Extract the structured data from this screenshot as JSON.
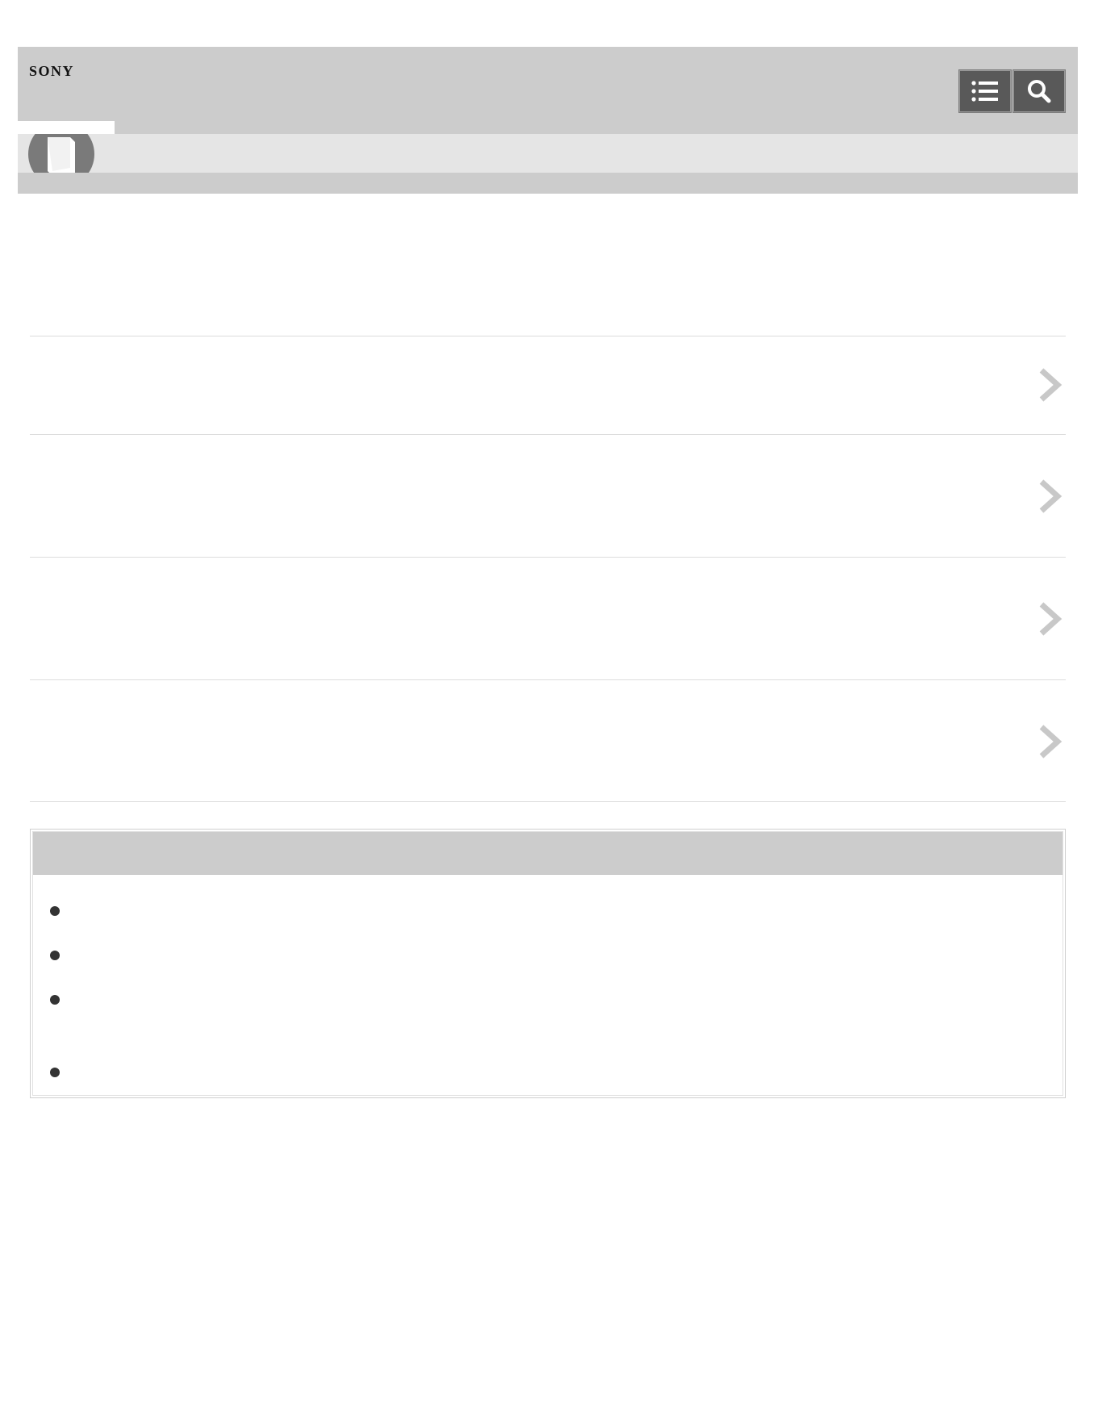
{
  "header": {
    "brand": "SONY",
    "toc_icon": "list-icon",
    "search_icon": "search-icon"
  },
  "category_icon": "book-icon",
  "list_items": [
    {
      "title": "",
      "icon": "chevron-right-icon"
    },
    {
      "title": "",
      "icon": "chevron-right-icon"
    },
    {
      "title": "",
      "icon": "chevron-right-icon"
    },
    {
      "title": "",
      "icon": "chevron-right-icon"
    }
  ],
  "note": {
    "title": "",
    "bullets": [
      "",
      "",
      "",
      ""
    ]
  },
  "colors": {
    "header_bg": "#cccccc",
    "subbar_bg": "#e5e5e5",
    "button_bg": "#595959",
    "chevron": "#c8c8c8"
  }
}
